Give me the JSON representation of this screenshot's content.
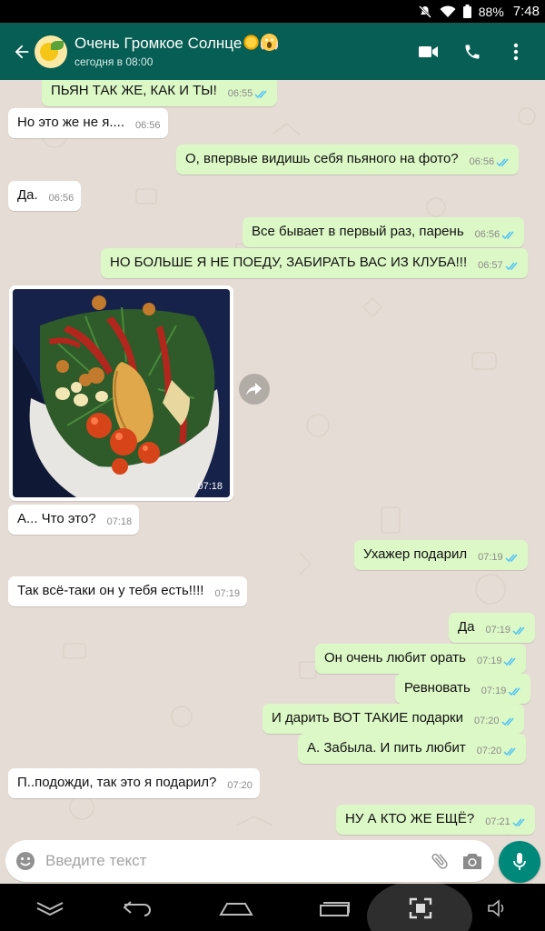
{
  "status_bar": {
    "battery": "88%",
    "time": "7:48"
  },
  "header": {
    "title": "Очень Громкое Солнце",
    "subtitle": "сегодня в 08:00",
    "icons": [
      "back-arrow-icon",
      "video-call-icon",
      "phone-icon",
      "more-vert-icon"
    ]
  },
  "messages": [
    {
      "dir": "out",
      "text": "ПЬЯН ТАК ЖЕ, КАК И ТЫ!",
      "time": "06:55",
      "read": true
    },
    {
      "dir": "in",
      "text": "Но это же не я....",
      "time": "06:56"
    },
    {
      "dir": "out",
      "text": "О, впервые видишь себя пьяного на фото?",
      "time": "06:56",
      "read": true
    },
    {
      "dir": "in",
      "text": "Да.",
      "time": "06:56"
    },
    {
      "dir": "out",
      "text": "Все бывает в первый раз, парень",
      "time": "06:56",
      "read": true
    },
    {
      "dir": "out",
      "text": "НО БОЛЬШЕ Я НЕ ПОЕДУ, ЗАБИРАТЬ ВАС ИЗ КЛУБА!!!",
      "time": "06:57",
      "read": true
    },
    {
      "dir": "in",
      "type": "photo",
      "time": "07:18"
    },
    {
      "dir": "in",
      "text": "А... Что это?",
      "time": "07:18"
    },
    {
      "dir": "out",
      "text": "Ухажер подарил",
      "time": "07:19",
      "read": true
    },
    {
      "dir": "in",
      "text": "Так всё-таки он у тебя есть!!!!",
      "time": "07:19"
    },
    {
      "dir": "out",
      "text": "Да",
      "time": "07:19",
      "read": true
    },
    {
      "dir": "out",
      "text": "Он очень любит орать",
      "time": "07:19",
      "read": true
    },
    {
      "dir": "out",
      "text": "Ревновать",
      "time": "07:19",
      "read": true
    },
    {
      "dir": "out",
      "text": "И дарить ВОТ ТАКИЕ подарки",
      "time": "07:20",
      "read": true
    },
    {
      "dir": "out",
      "text": "А. Забыла. И пить любит",
      "time": "07:20",
      "read": true
    },
    {
      "dir": "in",
      "text": "П..подожди, так это я подарил?",
      "time": "07:20"
    },
    {
      "dir": "out",
      "text": "НУ А КТО ЖЕ ЕЩЁ?",
      "time": "07:21",
      "read": true
    }
  ],
  "input": {
    "placeholder": "Введите текст"
  },
  "colors": {
    "header": "#075e54",
    "outgoing_bubble": "#dcf8c6",
    "incoming_bubble": "#ffffff",
    "read_ticks": "#4fc3f7",
    "mic_button": "#00897b"
  }
}
